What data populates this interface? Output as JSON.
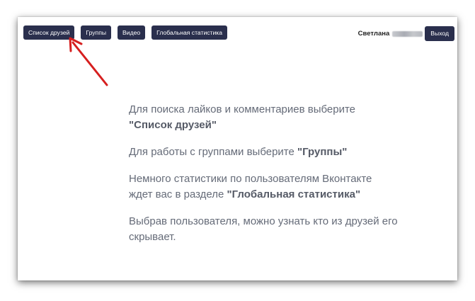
{
  "nav": {
    "friends_label": "Список друзей",
    "groups_label": "Группы",
    "video_label": "Видео",
    "global_stats_label": "Глобальная статистика"
  },
  "user": {
    "first_name": "Светлана",
    "surname_blurred": "Денисова",
    "logout_label": "Выход"
  },
  "info": {
    "p1_text": "Для поиска лайков и комментариев выберите ",
    "p1_highlight": "\"Список друзей\"",
    "p2_text": "Для работы с группами выберите ",
    "p2_highlight": "\"Группы\"",
    "p3_text": "Немного статистики по пользователям Вконтакте ждет вас в разделе ",
    "p3_highlight": "\"Глобальная статистика\"",
    "p4_text": "Выбрав пользователя, можно узнать кто из друзей его скрывает."
  },
  "annotation": {
    "arrow_color": "#d61f1f"
  },
  "colors": {
    "button_bg": "#2a2f4d",
    "text": "#656b78"
  }
}
